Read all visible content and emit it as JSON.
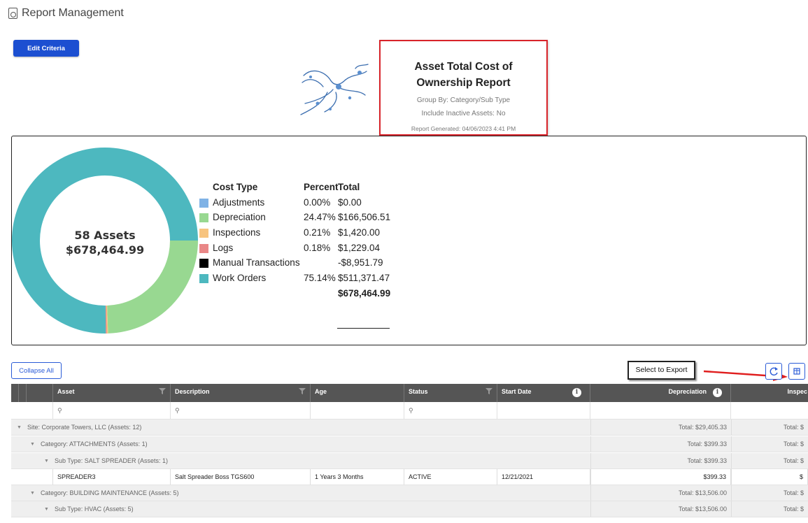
{
  "header": {
    "icon": "report-document-icon",
    "title": "Report Management"
  },
  "edit_criteria_label": "Edit Criteria",
  "report": {
    "title": "Asset Total Cost of Ownership Report",
    "group_by": "Group By: Category/Sub Type",
    "inactive": "Include Inactive Assets: No",
    "generated": "Report Generated: 04/06/2023 4:41 PM"
  },
  "donut_center": {
    "assets": "58 Assets",
    "total": "$678,464.99"
  },
  "legend": {
    "headers": {
      "cost_type": "Cost Type",
      "percent": "Percent",
      "total": "Total"
    },
    "rows": [
      {
        "name": "Adjustments",
        "percent": "0.00%",
        "total": "$0.00",
        "color": "#7fb2e5"
      },
      {
        "name": "Depreciation",
        "percent": "24.47%",
        "total": "$166,506.51",
        "color": "#98d891"
      },
      {
        "name": "Inspections",
        "percent": "0.21%",
        "total": "$1,420.00",
        "color": "#f7c47f"
      },
      {
        "name": "Logs",
        "percent": "0.18%",
        "total": "$1,229.04",
        "color": "#e98787"
      },
      {
        "name": "Manual Transactions",
        "percent": "",
        "total": "-$8,951.79",
        "color": "#000000"
      },
      {
        "name": "Work Orders",
        "percent": "75.14%",
        "total": "$511,371.47",
        "color": "#4db8bf"
      }
    ],
    "grand_total": "$678,464.99"
  },
  "chart_data": {
    "type": "pie",
    "categories": [
      "Adjustments",
      "Depreciation",
      "Inspections",
      "Logs",
      "Manual Transactions",
      "Work Orders"
    ],
    "values": [
      0.0,
      24.47,
      0.21,
      0.18,
      0.0,
      75.14
    ],
    "colors": [
      "#7fb2e5",
      "#98d891",
      "#f7c47f",
      "#e98787",
      "#000000",
      "#4db8bf"
    ],
    "center_label": [
      "58 Assets",
      "$678,464.99"
    ]
  },
  "toolbar": {
    "collapse_all": "Collapse All",
    "export_tooltip": "Select to Export",
    "refresh_icon": "refresh-icon",
    "export_icon": "export-icon"
  },
  "grid": {
    "columns": [
      "Asset",
      "Description",
      "Age",
      "Status",
      "Start Date",
      "Depreciation",
      "Inspec"
    ],
    "rows": [
      {
        "kind": "group",
        "level": 0,
        "label": "Site: Corporate Towers, LLC (Assets: 12)",
        "dep": "Total: $29,405.33",
        "insp": "Total: $"
      },
      {
        "kind": "group",
        "level": 1,
        "label": "Category: ATTACHMENTS (Assets: 1)",
        "dep": "Total: $399.33",
        "insp": "Total: $"
      },
      {
        "kind": "group",
        "level": 2,
        "label": "Sub Type: SALT SPREADER (Assets: 1)",
        "dep": "Total: $399.33",
        "insp": "Total: $"
      },
      {
        "kind": "data",
        "asset": "SPREADER3",
        "desc": "Salt Spreader Boss TGS600",
        "age": "1 Years 3 Months",
        "status": "ACTIVE",
        "start": "12/21/2021",
        "dep": "$399.33",
        "insp": "$"
      },
      {
        "kind": "group",
        "level": 1,
        "label": "Category: BUILDING MAINTENANCE (Assets: 5)",
        "dep": "Total: $13,506.00",
        "insp": "Total: $"
      },
      {
        "kind": "group",
        "level": 2,
        "label": "Sub Type: HVAC (Assets: 5)",
        "dep": "Total: $13,506.00",
        "insp": "Total: $"
      }
    ]
  }
}
